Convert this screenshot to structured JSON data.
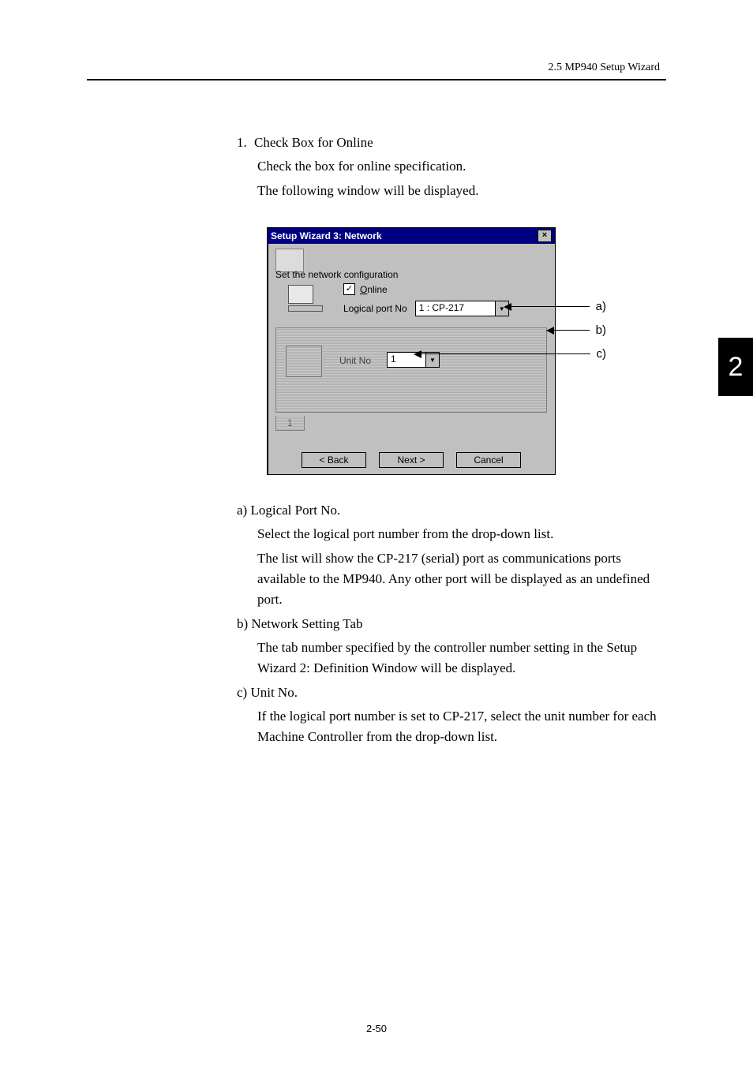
{
  "header": {
    "running_head": "2.5  MP940 Setup Wizard"
  },
  "chapter_tab": "2",
  "step": {
    "number": "1.",
    "title": "Check Box for Online",
    "lines": [
      "Check the box for online specification.",
      "The following window will be displayed."
    ]
  },
  "window": {
    "title": "Setup Wizard  3: Network",
    "close_glyph": "×",
    "caption": "Set the network configuration",
    "online": {
      "checked_glyph": "✓",
      "label_prefix": "O",
      "label_rest": "nline"
    },
    "logical_port": {
      "label": "Logical port No",
      "value": "1 : CP-217",
      "chevron": "▼"
    },
    "unit": {
      "label": "Unit No",
      "value": "1",
      "chevron": "▼"
    },
    "tabs": [
      {
        "label": "1"
      }
    ],
    "buttons": {
      "back": "< Back",
      "next": "Next >",
      "cancel": "Cancel"
    }
  },
  "callouts": {
    "a": "a)",
    "b": "b)",
    "c": "c)"
  },
  "body": {
    "a_head": "a) Logical Port No.",
    "a_p1": "Select the logical port number from the drop-down list.",
    "a_p2": "The list will show the CP-217 (serial) port as communications ports available to the MP940. Any other port will be displayed as an undefined port.",
    "b_head": "b) Network Setting Tab",
    "b_p1": "The tab number specified by the controller number setting in the Setup Wizard 2: Definition Window will be displayed.",
    "c_head": "c) Unit No.",
    "c_p1": "If the logical port number is set to CP-217, select the unit number for each Machine Controller from the drop-down list."
  },
  "footer": {
    "page_number": "2-50"
  }
}
